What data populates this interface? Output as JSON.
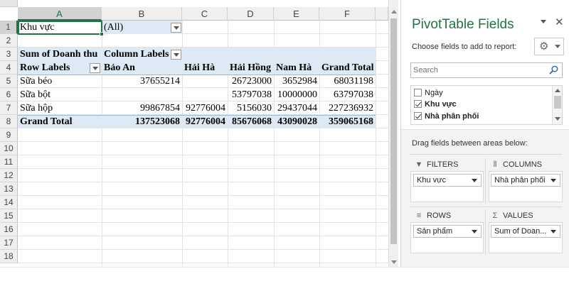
{
  "sheet": {
    "columns": [
      "A",
      "B",
      "C",
      "D",
      "E",
      "F"
    ],
    "rows": [
      "1",
      "2",
      "3",
      "4",
      "5",
      "6",
      "7",
      "8",
      "9",
      "10",
      "11",
      "12",
      "13",
      "14",
      "15",
      "16",
      "17",
      "18"
    ],
    "filter": {
      "label": "Khu vực",
      "value": "(All)"
    },
    "pivot": {
      "values_label": "Sum of Doanh thu",
      "column_labels": "Column Labels",
      "row_labels": "Row Labels",
      "headers": [
        "Bảo An",
        "Hải Hà",
        "Hải Hồng",
        "Nam Hà",
        "Grand Total"
      ],
      "rows": [
        {
          "label": "Sữa béo",
          "values": [
            "37655214",
            "",
            "26723000",
            "3652984",
            "68031198"
          ]
        },
        {
          "label": "Sữa bột",
          "values": [
            "",
            "",
            "53797038",
            "10000000",
            "63797038"
          ]
        },
        {
          "label": "Sữa hộp",
          "values": [
            "99867854",
            "92776004",
            "5156030",
            "29437044",
            "227236932"
          ]
        }
      ],
      "total": {
        "label": "Grand Total",
        "values": [
          "137523068",
          "92776004",
          "85676068",
          "43090028",
          "359065168"
        ]
      }
    }
  },
  "pane": {
    "title": "PivotTable Fields",
    "subtitle": "Choose fields to add to report:",
    "gear_icon": "gear-icon",
    "search_placeholder": "Search",
    "fields": [
      {
        "name": "Ngày",
        "checked": false
      },
      {
        "name": "Khu vực",
        "checked": true
      },
      {
        "name": "Nhà phân phối",
        "checked": true
      }
    ],
    "drag_hint": "Drag fields between areas below:",
    "areas": {
      "filters": {
        "title": "FILTERS",
        "item": "Khu vực"
      },
      "columns": {
        "title": "COLUMNS",
        "item": "Nhà phân phối"
      },
      "rows": {
        "title": "ROWS",
        "item": "Sản phẩm"
      },
      "values": {
        "title": "VALUES",
        "item": "Sum of Doan..."
      }
    }
  },
  "colors": {
    "accent": "#217346",
    "pivot_band": "#dde9f5"
  }
}
